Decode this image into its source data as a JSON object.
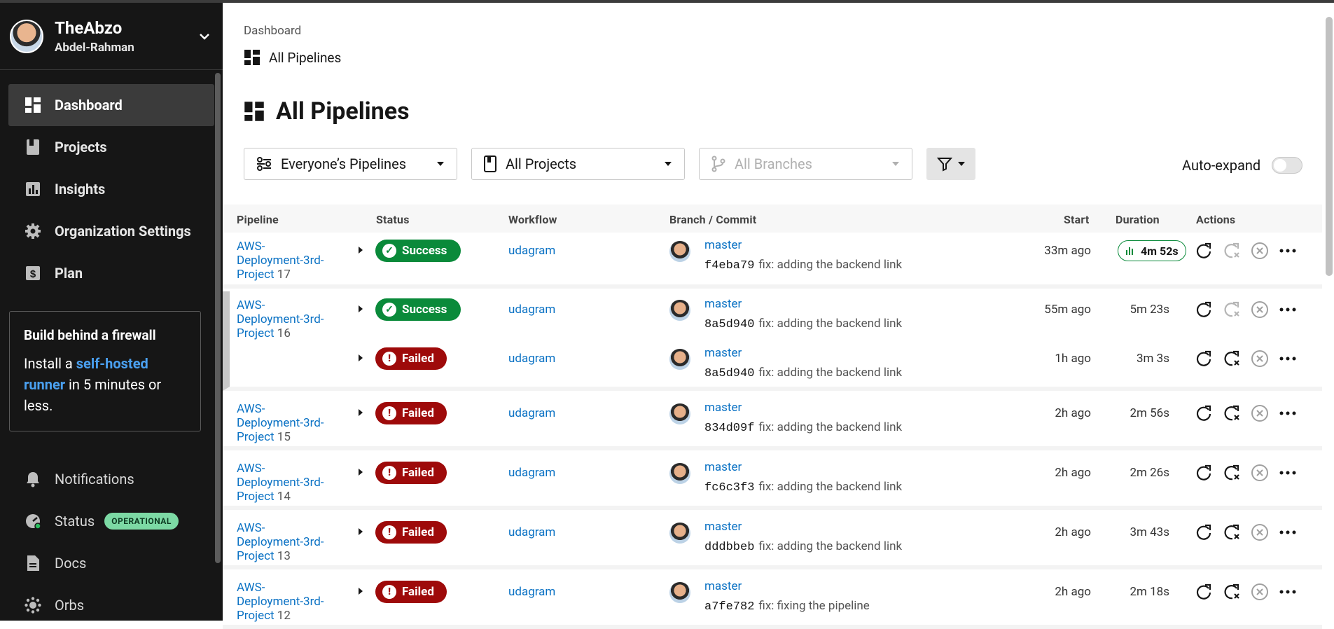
{
  "org": {
    "name": "TheAbzo",
    "user": "Abdel-Rahman"
  },
  "nav": [
    {
      "label": "Dashboard",
      "icon": "dashboard-icon",
      "active": true
    },
    {
      "label": "Projects",
      "icon": "projects-icon"
    },
    {
      "label": "Insights",
      "icon": "insights-icon"
    },
    {
      "label": "Organization Settings",
      "icon": "gear-icon"
    },
    {
      "label": "Plan",
      "icon": "dollar-icon"
    }
  ],
  "promo": {
    "title": "Build behind a firewall",
    "prefix": "Install a ",
    "link": "self-hosted runner",
    "suffix": " in 5 minutes or less."
  },
  "nav_bottom": [
    {
      "label": "Notifications",
      "icon": "bell-icon"
    },
    {
      "label": "Status",
      "icon": "status-icon",
      "badge": "OPERATIONAL"
    },
    {
      "label": "Docs",
      "icon": "docs-icon"
    },
    {
      "label": "Orbs",
      "icon": "orbs-icon"
    }
  ],
  "breadcrumb": {
    "root": "Dashboard",
    "current": "All Pipelines"
  },
  "page_title": "All Pipelines",
  "filters": {
    "pipelines": "Everyone’s Pipelines",
    "projects": "All Projects",
    "branches": "All Branches"
  },
  "auto_expand": {
    "label": "Auto-expand",
    "on": false
  },
  "table": {
    "headers": {
      "pipeline": "Pipeline",
      "status": "Status",
      "workflow": "Workflow",
      "branch": "Branch / Commit",
      "start": "Start",
      "duration": "Duration",
      "actions": "Actions"
    },
    "rows": [
      {
        "pipeline": "AWS-Deployment-3rd-Project",
        "num": "17",
        "status": "Success",
        "workflow": "udagram",
        "branch": "master",
        "sha": "f4eba79",
        "msg": "fix: adding the backend link",
        "start": "33m ago",
        "duration": "4m 52s",
        "duration_pill": true
      },
      {
        "pipeline": "AWS-Deployment-3rd-Project",
        "num": "16",
        "status": "Success",
        "workflow": "udagram",
        "branch": "master",
        "sha": "8a5d940",
        "msg": "fix: adding the backend link",
        "start": "55m ago",
        "duration": "5m 23s"
      },
      {
        "pipeline": "",
        "num": "",
        "status": "Failed",
        "workflow": "udagram",
        "branch": "master",
        "sha": "8a5d940",
        "msg": "fix: adding the backend link",
        "start": "1h ago",
        "duration": "3m 3s"
      },
      {
        "pipeline": "AWS-Deployment-3rd-Project",
        "num": "15",
        "status": "Failed",
        "workflow": "udagram",
        "branch": "master",
        "sha": "834d09f",
        "msg": "fix: adding the backend link",
        "start": "2h ago",
        "duration": "2m 56s"
      },
      {
        "pipeline": "AWS-Deployment-3rd-Project",
        "num": "14",
        "status": "Failed",
        "workflow": "udagram",
        "branch": "master",
        "sha": "fc6c3f3",
        "msg": "fix: adding the backend link",
        "start": "2h ago",
        "duration": "2m 26s"
      },
      {
        "pipeline": "AWS-Deployment-3rd-Project",
        "num": "13",
        "status": "Failed",
        "workflow": "udagram",
        "branch": "master",
        "sha": "dddbbeb",
        "msg": "fix: adding the backend link",
        "start": "2h ago",
        "duration": "3m 43s"
      },
      {
        "pipeline": "AWS-Deployment-3rd-Project",
        "num": "12",
        "status": "Failed",
        "workflow": "udagram",
        "branch": "master",
        "sha": "a7fe782",
        "msg": "fix: fixing the pipeline",
        "start": "2h ago",
        "duration": "2m 18s"
      }
    ]
  },
  "colors": {
    "success": "#0a8a3a",
    "failed": "#9e0a0a",
    "link": "#0b72c4",
    "sidebar": "#161616"
  }
}
